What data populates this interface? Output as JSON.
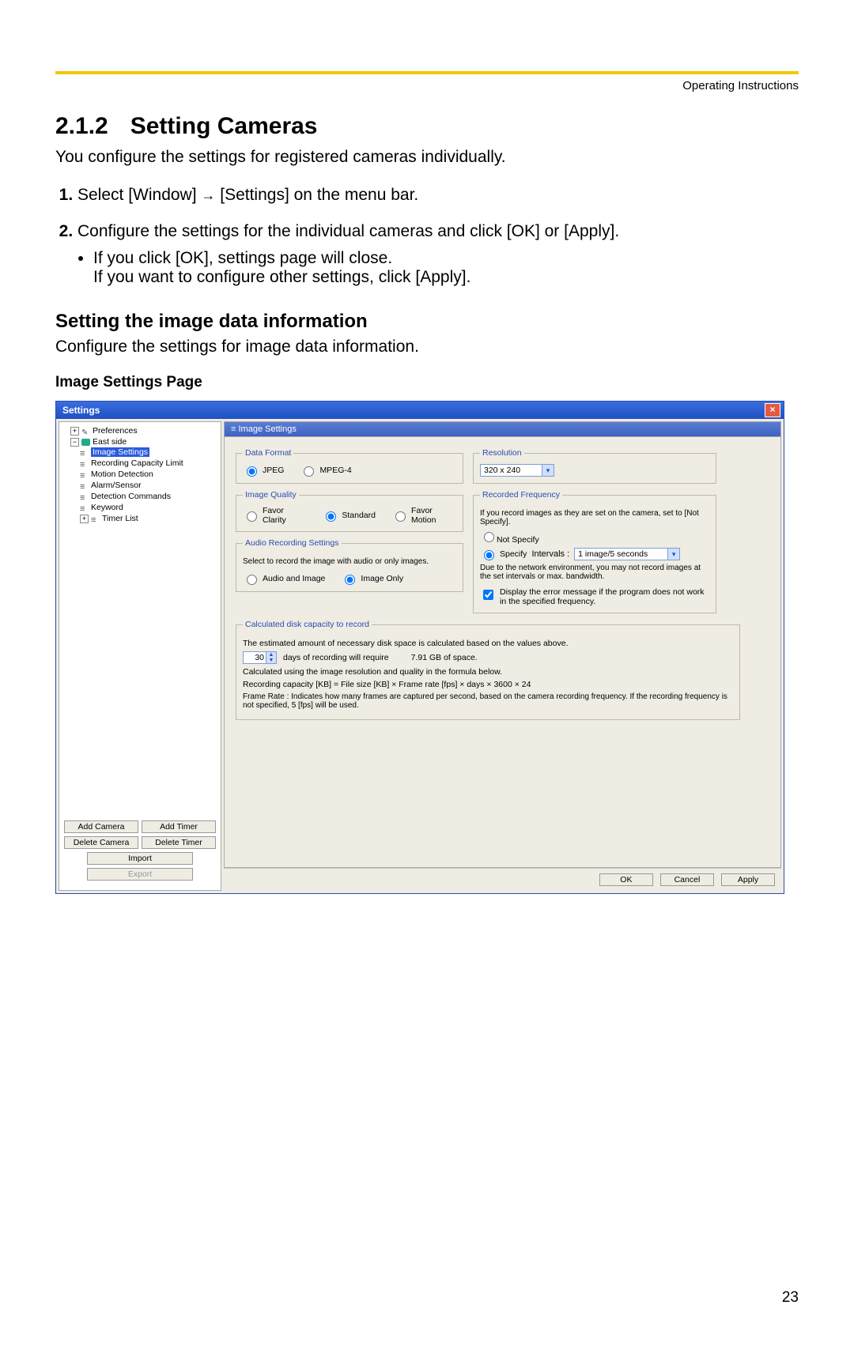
{
  "header": {
    "right": "Operating Instructions"
  },
  "section": {
    "number": "2.1.2",
    "title": "Setting Cameras"
  },
  "intro": "You configure the settings for registered cameras individually.",
  "steps": {
    "s1_a": "Select [Window] ",
    "s1_b": " [Settings] on the menu bar.",
    "s2": "Configure the settings for the individual cameras and click [OK] or [Apply].",
    "s2_b1": "If you click [OK], settings page will close.",
    "s2_b2": "If you want to configure other settings, click [Apply]."
  },
  "subhead": "Setting the image data information",
  "subpara": "Configure the settings for image data information.",
  "caption": "Image Settings Page",
  "page_number": "23",
  "window": {
    "title": "Settings",
    "close_x": "×",
    "tab_title": "Image Settings",
    "tree": {
      "preferences": "Preferences",
      "camera": "East side",
      "image_settings": "Image Settings",
      "recording_cap": "Recording Capacity Limit",
      "motion_detection": "Motion Detection",
      "alarm_sensor": "Alarm/Sensor",
      "detection_commands": "Detection Commands",
      "keyword": "Keyword",
      "timer_list": "Timer List"
    },
    "left_buttons": {
      "add_camera": "Add Camera",
      "add_timer": "Add Timer",
      "delete_camera": "Delete Camera",
      "delete_timer": "Delete Timer",
      "import": "Import",
      "export": "Export"
    },
    "groups": {
      "data_format": {
        "legend": "Data Format",
        "jpeg": "JPEG",
        "mpeg4": "MPEG-4"
      },
      "resolution": {
        "legend": "Resolution",
        "value": "320 x 240"
      },
      "image_quality": {
        "legend": "Image Quality",
        "clarity": "Favor Clarity",
        "standard": "Standard",
        "motion": "Favor Motion"
      },
      "recorded_freq": {
        "legend": "Recorded Frequency",
        "note1": "If you record images as they are set on the camera, set to [Not Specify].",
        "not_specify": "Not Specify",
        "specify": "Specify",
        "intervals_label": "Intervals :",
        "intervals_value": "1 image/5 seconds",
        "note2": "Due to the network environment, you may not record images at the set intervals or max. bandwidth.",
        "chk_label": "Display the error message if the program does not work in the specified frequency."
      },
      "audio": {
        "legend": "Audio Recording Settings",
        "intro": "Select to record the image with audio or only images.",
        "audio_image": "Audio and Image",
        "image_only": "Image Only"
      },
      "calc": {
        "legend": "Calculated disk capacity to record",
        "l1": "The estimated amount of necessary disk space is calculated based on the values above.",
        "days_value": "30",
        "days_text": "days of recording will require",
        "gb_text": "7.91 GB of space.",
        "l3": "Calculated using the image resolution and quality in the formula below.",
        "formula": "Recording capacity [KB] = File size [KB] × Frame rate [fps] × days × 3600 × 24",
        "frame_rate_note": "Frame Rate :  Indicates how many frames are captured per second, based on the camera recording frequency. If the recording frequency is not specified, 5 [fps] will be used."
      }
    },
    "bottom": {
      "ok": "OK",
      "cancel": "Cancel",
      "apply": "Apply"
    }
  }
}
